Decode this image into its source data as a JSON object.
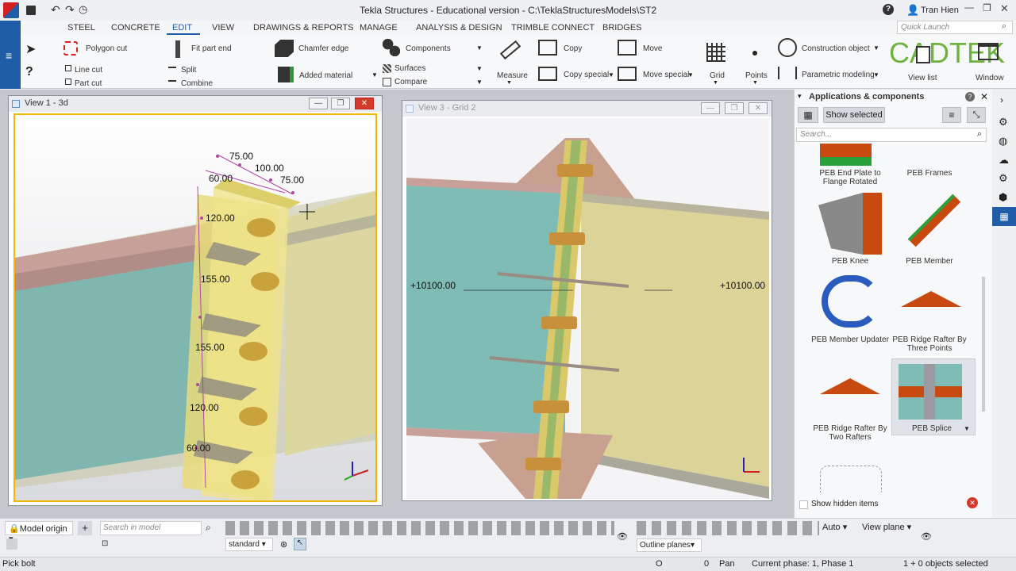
{
  "window": {
    "title": "Tekla Structures - Educational version - C:\\TeklaStructuresModels\\ST2",
    "user": "Tran Hien",
    "help": "?"
  },
  "menu": [
    "STEEL",
    "CONCRETE",
    "EDIT",
    "VIEW",
    "DRAWINGS & REPORTS",
    "MANAGE",
    "ANALYSIS & DESIGN",
    "TRIMBLE CONNECT",
    "BRIDGES"
  ],
  "active_menu": "EDIT",
  "quick_launch_placeholder": "Quick Launch",
  "ribbon": {
    "polygon_cut": "Polygon cut",
    "line_cut": "Line cut",
    "part_cut": "Part cut",
    "fit_part_end": "Fit part end",
    "split": "Split",
    "combine": "Combine",
    "chamfer_edge": "Chamfer edge",
    "added_material": "Added material",
    "components": "Components",
    "surfaces": "Surfaces",
    "compare": "Compare",
    "measure": "Measure",
    "copy": "Copy",
    "copy_special": "Copy special",
    "move": "Move",
    "move_special": "Move special",
    "grid": "Grid",
    "points": "Points",
    "construction_object": "Construction object",
    "parametric_modeling": "Parametric modeling",
    "view_list": "View list",
    "window": "Window",
    "logo": "CADTEK"
  },
  "view1": {
    "title": "View 1 - 3d",
    "dims": [
      "75.00",
      "100.00",
      "75.00",
      "60.00",
      "120.00",
      "155.00",
      "155.00",
      "120.00",
      "60.00"
    ]
  },
  "view3": {
    "title": "View 3 - Grid 2",
    "level_left": "+10100.00",
    "level_right": "+10100.00"
  },
  "panel": {
    "title": "Applications & components",
    "show_selected": "Show selected",
    "search_placeholder": "Search...",
    "items": [
      "PEB End Plate to Flange Rotated",
      "PEB Frames",
      "PEB Knee",
      "PEB Member",
      "PEB Member Updater",
      "PEB Ridge Rafter By Three Points",
      "PEB Ridge Rafter By Two Rafters",
      "PEB Splice"
    ],
    "show_hidden": "Show hidden items"
  },
  "bottom": {
    "model_origin": "Model origin",
    "search_model_placeholder": "Search in model",
    "standard": "standard",
    "auto": "Auto",
    "view_plane": "View plane",
    "outline_planes": "Outline planes"
  },
  "status": {
    "prompt": "Pick bolt",
    "o": "O",
    "zero": "0",
    "pan": "Pan",
    "phase": "Current phase: 1, Phase 1",
    "selected": "1 + 0 objects selected"
  }
}
